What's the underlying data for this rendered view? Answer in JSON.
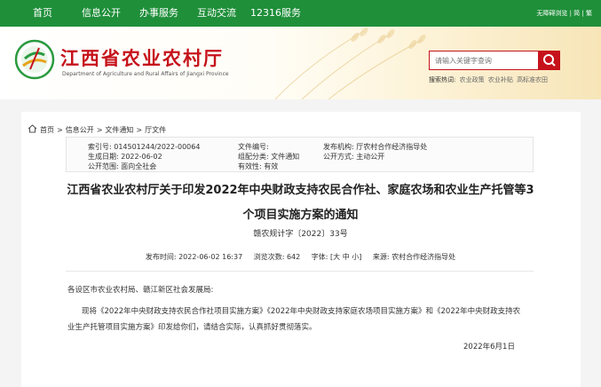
{
  "nav": {
    "items": [
      "首页",
      "信息公开",
      "办事服务",
      "互动交流",
      "12316服务"
    ],
    "right_links": "无障碍浏览 | 简 | 繁"
  },
  "header": {
    "site_title": "江西省农业农村厅",
    "site_subtitle": "Department of Agriculture and Rural Affairs of Jiangxi Province",
    "search_placeholder": "请输入关键字查询",
    "hot_label": "搜索热词:",
    "hot_words": [
      "农业政策",
      "农业补贴",
      "高标准农田"
    ]
  },
  "breadcrumb": [
    "首页",
    "信息公开",
    "文件通知",
    "厅文件"
  ],
  "meta": {
    "index_no": "索引号: 014501244/2022-00064",
    "doc_no": "文件编号:",
    "publisher": "发布机构: 厅农村合作经济指导处",
    "created": "生成日期: 2022-06-02",
    "category": "组配分类: 文件通知",
    "open_mode": "公开方式: 主动公开",
    "scope": "公开范围: 面向全社会",
    "validity": "有效性: 有效"
  },
  "doc": {
    "title_line1": "江西省农业农村厅关于印发2022年中央财政支持农民合作社、家庭农场和农业生产托管等3",
    "title_line2": "个项目实施方案的通知",
    "doc_number": "赣农规计字〔2022〕33号"
  },
  "info_bar": {
    "publish_time": "发布时间: 2022-06-02 16:37",
    "views": "浏览次数: 642",
    "font_label": "字体: [",
    "font_large": "大",
    "font_medium": "中",
    "font_small": "小",
    "font_close": "]",
    "source": "来源: 农村合作经济指导处"
  },
  "body": {
    "salutation": "各设区市农业农村局、赣江新区社会发展局:",
    "para_line1": "现将《2022年中央财政支持农民合作社项目实施方案》《2022年中央财政支持家庭农场项目实施方案》和《2022年中央财政支持农",
    "para_line2": "业生产托管项目实施方案》印发给你们，请结合实际，认真抓好贯彻落实。",
    "date": "2022年6月1日"
  },
  "colors": {
    "nav_green": "#1f8f3a",
    "brand_red": "#c6121b"
  }
}
